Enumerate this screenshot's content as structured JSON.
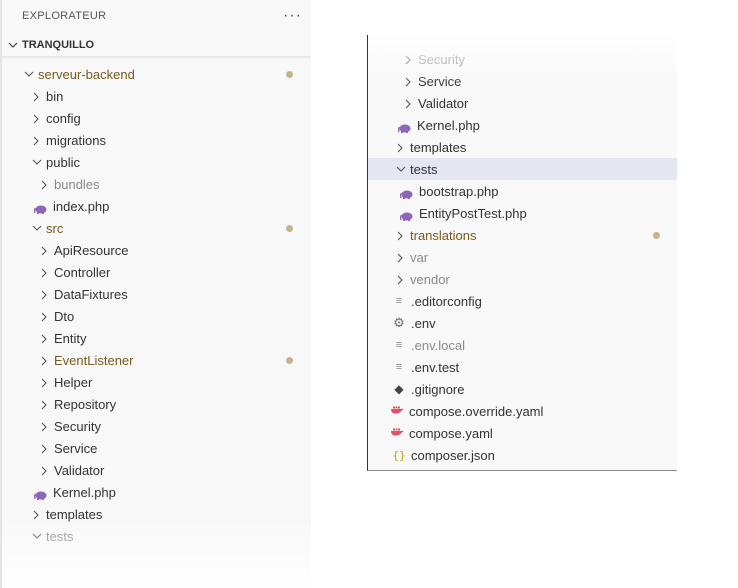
{
  "explorer": {
    "title": "EXPLORATEUR",
    "more_icon": "more-icon",
    "section": "TRANQUILLO"
  },
  "left_tree": [
    {
      "label": "serveur-backend",
      "type": "folder-open",
      "style": "mod",
      "modified": true
    },
    {
      "label": "bin",
      "type": "folder"
    },
    {
      "label": "config",
      "type": "folder"
    },
    {
      "label": "migrations",
      "type": "folder"
    },
    {
      "label": "public",
      "type": "folder-open"
    },
    {
      "label": "bundles",
      "type": "folder",
      "style": "dim"
    },
    {
      "label": "index.php",
      "type": "php"
    },
    {
      "label": "src",
      "type": "folder-open",
      "style": "mod",
      "modified": true
    },
    {
      "label": "ApiResource",
      "type": "folder"
    },
    {
      "label": "Controller",
      "type": "folder"
    },
    {
      "label": "DataFixtures",
      "type": "folder"
    },
    {
      "label": "Dto",
      "type": "folder"
    },
    {
      "label": "Entity",
      "type": "folder"
    },
    {
      "label": "EventListener",
      "type": "folder",
      "style": "mod",
      "modified": true
    },
    {
      "label": "Helper",
      "type": "folder"
    },
    {
      "label": "Repository",
      "type": "folder"
    },
    {
      "label": "Security",
      "type": "folder"
    },
    {
      "label": "Service",
      "type": "folder"
    },
    {
      "label": "Validator",
      "type": "folder"
    },
    {
      "label": "Kernel.php",
      "type": "php"
    },
    {
      "label": "templates",
      "type": "folder"
    },
    {
      "label": "tests",
      "type": "folder-open",
      "style": "dim"
    }
  ],
  "right_tree": [
    {
      "label": "Security",
      "type": "folder",
      "style": "dim"
    },
    {
      "label": "Service",
      "type": "folder"
    },
    {
      "label": "Validator",
      "type": "folder"
    },
    {
      "label": "Kernel.php",
      "type": "php"
    },
    {
      "label": "templates",
      "type": "folder"
    },
    {
      "label": "tests",
      "type": "folder-open",
      "selected": true
    },
    {
      "label": "bootstrap.php",
      "type": "php"
    },
    {
      "label": "EntityPostTest.php",
      "type": "php"
    },
    {
      "label": "translations",
      "type": "folder",
      "style": "mod",
      "modified": true
    },
    {
      "label": "var",
      "type": "folder",
      "style": "dim"
    },
    {
      "label": "vendor",
      "type": "folder",
      "style": "dim"
    },
    {
      "label": ".editorconfig",
      "type": "lines"
    },
    {
      "label": ".env",
      "type": "gear"
    },
    {
      "label": ".env.local",
      "type": "lines",
      "style": "dim"
    },
    {
      "label": ".env.test",
      "type": "lines"
    },
    {
      "label": ".gitignore",
      "type": "git"
    },
    {
      "label": "compose.override.yaml",
      "type": "docker"
    },
    {
      "label": "compose.yaml",
      "type": "docker"
    },
    {
      "label": "composer.json",
      "type": "json"
    }
  ],
  "icons": {
    "php": "php-elephant-icon",
    "docker": "docker-icon",
    "git": "git-icon",
    "gear": "gear-icon",
    "lines": "file-lines-icon",
    "json": "json-braces-icon"
  },
  "colors": {
    "modified_text": "#7a5a1e",
    "modified_dot": "#c8b28c",
    "dim_text": "#8a8a8a",
    "selection": "#e4e6f1",
    "php": "#8e66b8",
    "docker": "#e2506a",
    "json": "#b8a400"
  }
}
